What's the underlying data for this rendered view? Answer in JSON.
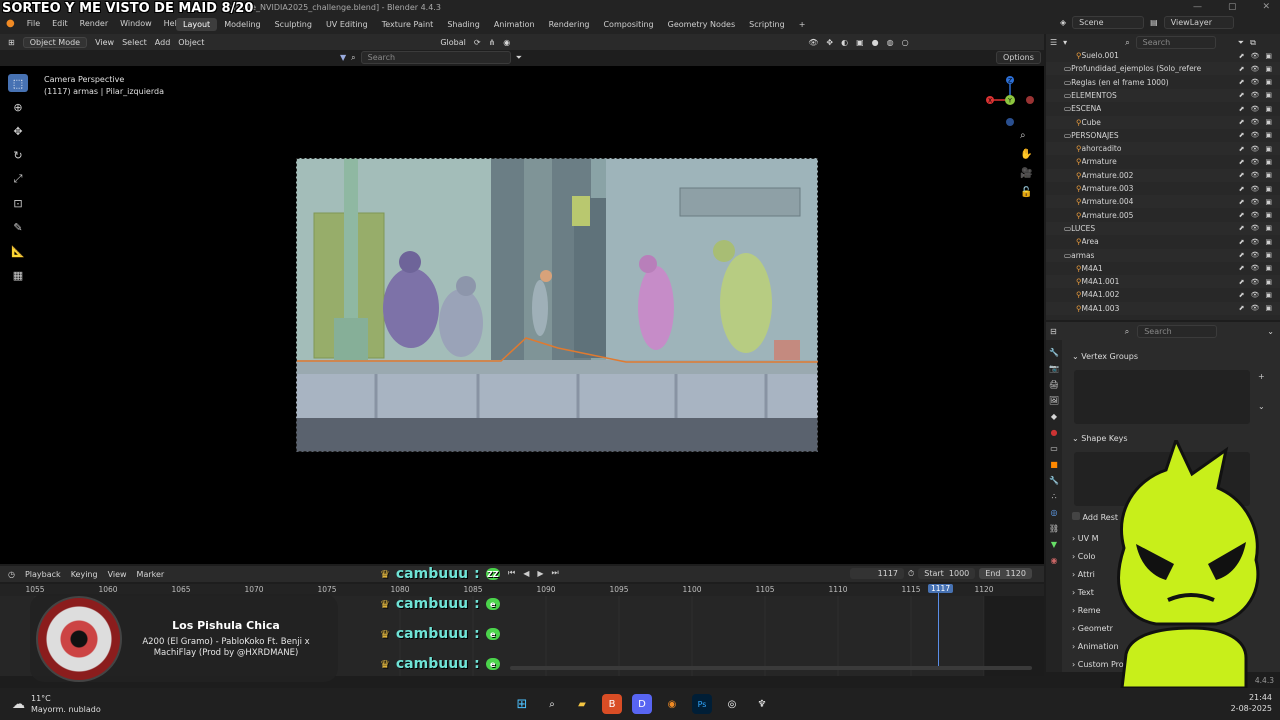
{
  "overlay_title": "SORTEO Y ME VISTO DE MAID 8/20",
  "window_title": "mplate_NVIDIA2025_challenge.blend] - Blender 4.4.3",
  "menu": [
    "File",
    "Edit",
    "Render",
    "Window",
    "Help"
  ],
  "workspaces": [
    "Layout",
    "Modeling",
    "Sculpting",
    "UV Editing",
    "Texture Paint",
    "Shading",
    "Animation",
    "Rendering",
    "Compositing",
    "Geometry Nodes",
    "Scripting"
  ],
  "scene_name": "Scene",
  "view_layer": "ViewLayer",
  "viewport_header": {
    "mode": "Object Mode",
    "menus": [
      "View",
      "Select",
      "Add",
      "Object"
    ],
    "transform": "Global",
    "options": "Options",
    "search_placeholder": "Search"
  },
  "camera_info": {
    "line1": "Camera Perspective",
    "line2": "(1117) armas | Pilar_izquierda"
  },
  "gizmo": {
    "x": "X",
    "y": "Y",
    "z": "Z"
  },
  "timeline": {
    "menus": [
      "Playback",
      "Keying",
      "View",
      "Marker"
    ],
    "current_frame": "1117",
    "start_label": "Start",
    "start": "1000",
    "end_label": "End",
    "end": "1120",
    "ticks": [
      "1055",
      "1060",
      "1065",
      "1070",
      "1075",
      "1080",
      "1085",
      "1090",
      "1095",
      "1100",
      "1105",
      "1110",
      "1115",
      "1117",
      "1120"
    ]
  },
  "outliner": {
    "search_placeholder": "Search",
    "items": [
      {
        "label": "Suelo.001",
        "indent": 2
      },
      {
        "label": "Profundidad_ejemplos (Solo_referenc",
        "indent": 1
      },
      {
        "label": "Reglas (en el frame 1000)",
        "indent": 1
      },
      {
        "label": "ELEMENTOS",
        "indent": 1
      },
      {
        "label": "ESCENA",
        "indent": 1
      },
      {
        "label": "Cube",
        "indent": 2
      },
      {
        "label": "PERSONAJES",
        "indent": 1
      },
      {
        "label": "ahorcadito",
        "indent": 2
      },
      {
        "label": "Armature",
        "indent": 2
      },
      {
        "label": "Armature.002",
        "indent": 2
      },
      {
        "label": "Armature.003",
        "indent": 2
      },
      {
        "label": "Armature.004",
        "indent": 2
      },
      {
        "label": "Armature.005",
        "indent": 2
      },
      {
        "label": "LUCES",
        "indent": 1
      },
      {
        "label": "Area",
        "indent": 2
      },
      {
        "label": "armas",
        "indent": 1
      },
      {
        "label": "M4A1",
        "indent": 2
      },
      {
        "label": "M4A1.001",
        "indent": 2
      },
      {
        "label": "M4A1.002",
        "indent": 2
      },
      {
        "label": "M4A1.003",
        "indent": 2
      }
    ]
  },
  "properties": {
    "search_placeholder": "Search",
    "vertex_groups": "Vertex Groups",
    "shape_keys": "Shape Keys",
    "add_rest": "Add Rest",
    "uv_maps": "UV M",
    "color_attrs": "Colo",
    "attributes": "Attri",
    "texture_space": "Text",
    "remesh": "Reme",
    "geometry_data": "Geometr",
    "animation": "Animation",
    "custom_properties": "Custom Properties"
  },
  "chat_overlay": {
    "name": "cambuuu",
    "colon": ":",
    "bubble_text": "ZZ"
  },
  "music": {
    "title": "Los Pishula Chica",
    "artist": "A200 (El Gramo) - PabloKoko Ft. Benji x MachiFlay (Prod by @HXRDMANE)"
  },
  "taskbar": {
    "temperature": "11°C",
    "weather": "Mayorm. nublado",
    "time": "21:44",
    "date": "2-08-2025"
  },
  "version": "4.4.3",
  "colors": {
    "accent": "#4772b3",
    "mascot": "#c8ef1a",
    "chat_name": "#6fe3d6"
  }
}
